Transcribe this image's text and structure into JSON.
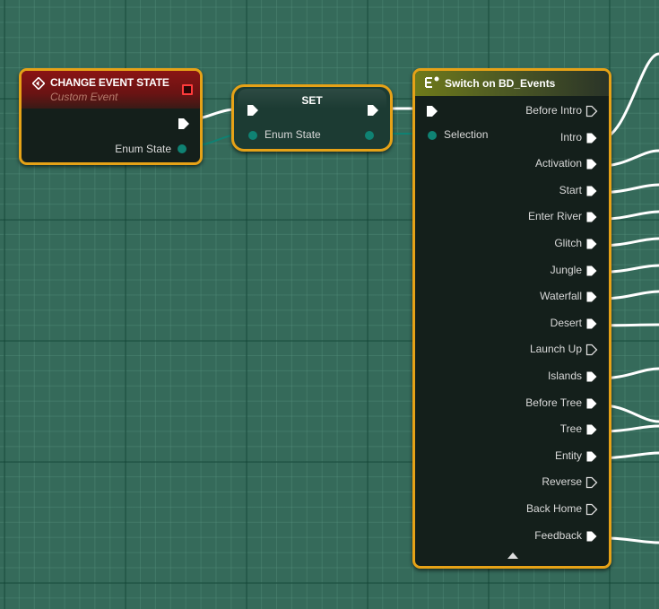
{
  "colors": {
    "background": "#356a5a",
    "node_border_selected": "#e6a217",
    "node_body": "#141f1b",
    "event_header": "#8a1414",
    "switch_header": "#6f7a1a",
    "exec_wire": "#ffffff",
    "enum_pin": "#0f8273"
  },
  "event_node": {
    "icon": "custom-event-icon",
    "title": "CHANGE EVENT STATE",
    "subtitle": "Custom Event",
    "delegate_pin": "delegate-pin-icon",
    "outputs": [
      {
        "label": "",
        "type": "exec"
      },
      {
        "label": "Enum State",
        "type": "enum"
      }
    ]
  },
  "set_node": {
    "title": "SET",
    "inputs": [
      {
        "label": "",
        "type": "exec"
      },
      {
        "label": "Enum State",
        "type": "enum"
      }
    ]
  },
  "switch_node": {
    "icon": "switch-enum-icon",
    "title": "Switch on BD_Events",
    "inputs": [
      {
        "label": "",
        "type": "exec"
      },
      {
        "label": "Selection",
        "type": "enum"
      }
    ],
    "outputs": [
      {
        "label": "Before Intro",
        "connected": false
      },
      {
        "label": "Intro",
        "connected": true
      },
      {
        "label": "Activation",
        "connected": true
      },
      {
        "label": "Start",
        "connected": true
      },
      {
        "label": "Enter River",
        "connected": true
      },
      {
        "label": "Glitch",
        "connected": true
      },
      {
        "label": "Jungle",
        "connected": true
      },
      {
        "label": "Waterfall",
        "connected": true
      },
      {
        "label": "Desert",
        "connected": true
      },
      {
        "label": "Launch Up",
        "connected": false
      },
      {
        "label": "Islands",
        "connected": true
      },
      {
        "label": "Before Tree",
        "connected": true
      },
      {
        "label": "Tree",
        "connected": true
      },
      {
        "label": "Entity",
        "connected": true
      },
      {
        "label": "Reverse",
        "connected": false
      },
      {
        "label": "Back Home",
        "connected": false
      },
      {
        "label": "Feedback",
        "connected": true
      }
    ],
    "collapse_icon": "advanced-display-arrow-icon"
  }
}
